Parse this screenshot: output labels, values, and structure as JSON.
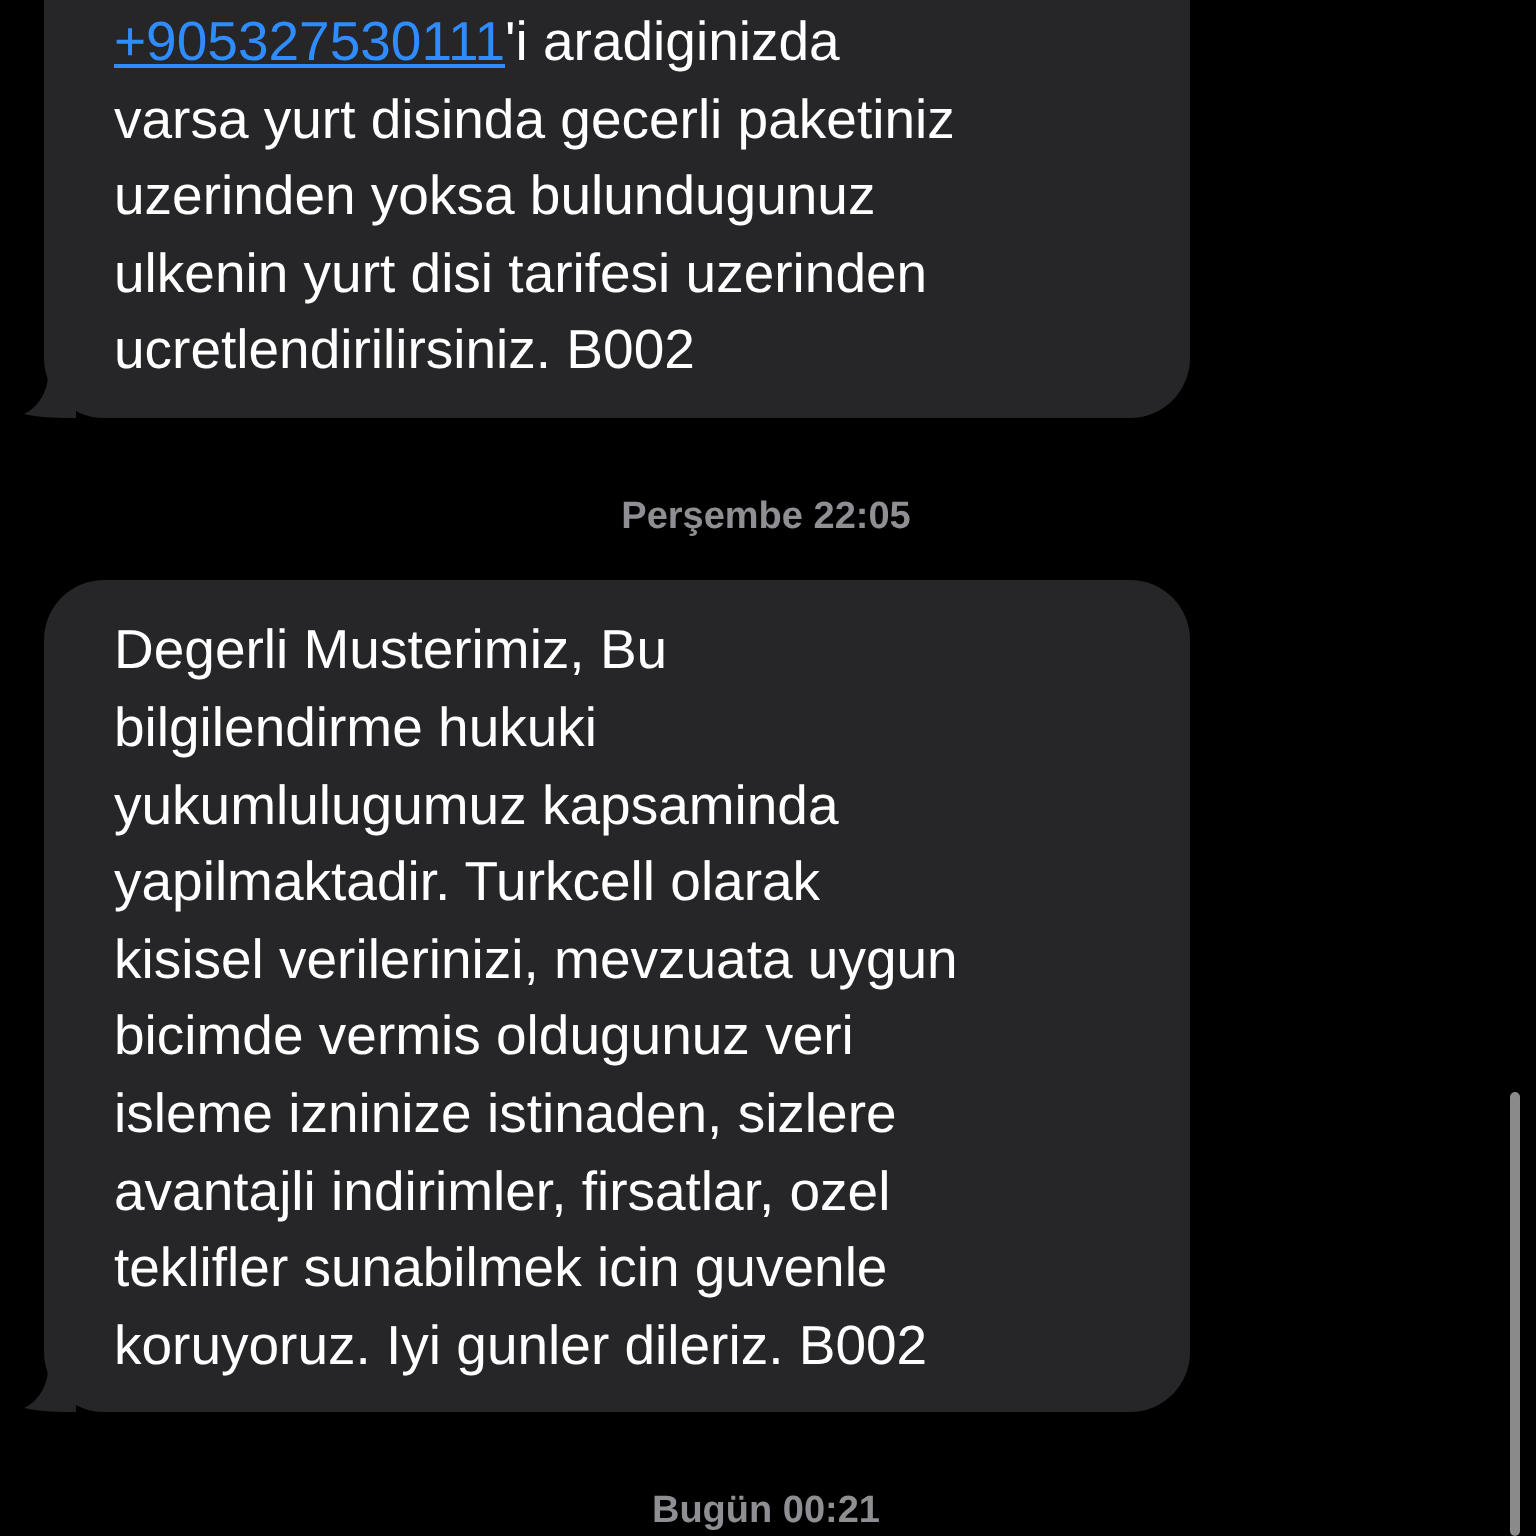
{
  "messages": [
    {
      "kind": "message",
      "link": "+905327530111",
      "lines": [
        "'i aradiginizda",
        "varsa yurt disinda gecerli paketiniz",
        "uzerinden yoksa bulundugunuz",
        "ulkenin yurt disi tarifesi uzerinden",
        "ucretlendirilirsiniz. B002"
      ]
    },
    {
      "kind": "timestamp",
      "text": "Perşembe 22:05"
    },
    {
      "kind": "message",
      "lines": [
        "Degerli Musterimiz, Bu",
        "bilgilendirme hukuki",
        "yukumlulugumuz kapsaminda",
        "yapilmaktadir. Turkcell olarak",
        "kisisel verilerinizi, mevzuata uygun",
        "bicimde vermis oldugunuz veri",
        "isleme izninize istinaden, sizlere",
        "avantajli indirimler, firsatlar, ozel",
        "teklifler sunabilmek icin guvenle",
        "koruyoruz. Iyi gunler dileriz. B002"
      ]
    },
    {
      "kind": "timestamp",
      "text": "Bugün 00:21"
    }
  ]
}
